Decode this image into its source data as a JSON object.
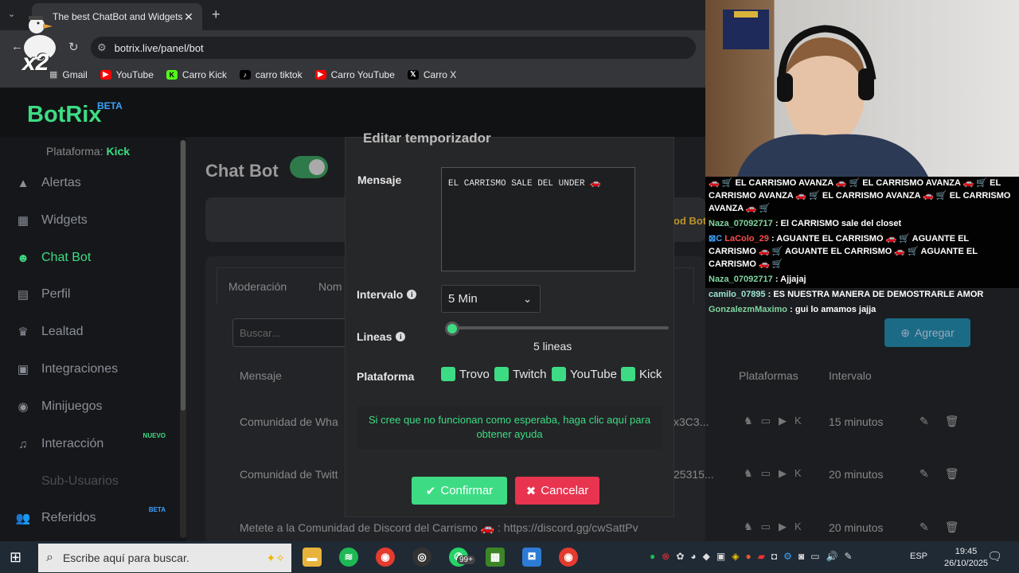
{
  "browser": {
    "tab_title": "The best ChatBot and Widgets",
    "tab_close": "✕",
    "new_tab": "+",
    "url": "botrix.live/panel/bot",
    "bookmarks": [
      {
        "label": "Gmail",
        "icon": "apps-icon",
        "color": "#888888"
      },
      {
        "label": "YouTube",
        "icon": "youtube-icon",
        "color": "#ff0000"
      },
      {
        "label": "Carro Kick",
        "icon": "kick-icon",
        "color": "#53fc18"
      },
      {
        "label": "carro tiktok",
        "icon": "tiktok-icon",
        "color": "#000000"
      },
      {
        "label": "Carro YouTube",
        "icon": "youtube-icon",
        "color": "#ff0000"
      },
      {
        "label": "Carro X",
        "icon": "x-icon",
        "color": "#000000"
      }
    ],
    "overlay_x2": "x2"
  },
  "app": {
    "logo": "BotRix",
    "beta": "BETA",
    "accent": "#3ddc84",
    "platform_label": "Plataforma:",
    "platform_value": "Kick"
  },
  "sidebar": {
    "items": [
      {
        "label": "Alertas",
        "icon": "warning-icon"
      },
      {
        "label": "Widgets",
        "icon": "widgets-icon"
      },
      {
        "label": "Chat Bot",
        "icon": "bot-icon",
        "active": true
      },
      {
        "label": "Perfil",
        "icon": "profile-card-icon"
      },
      {
        "label": "Lealtad",
        "icon": "trophy-icon"
      },
      {
        "label": "Integraciones",
        "icon": "integrations-icon"
      },
      {
        "label": "Minijuegos",
        "icon": "gamepad-icon"
      },
      {
        "label": "Interacción",
        "icon": "music-icon",
        "tag": "NUEVO"
      },
      {
        "label": "Sub-Usuarios",
        "icon": "",
        "disabled": true
      },
      {
        "label": "Referidos",
        "icon": "users-icon",
        "tag": "BETA"
      }
    ]
  },
  "main": {
    "title": "Chat Bot",
    "banner_text": "od BotRix ... la funció",
    "tabs": [
      "Moderación",
      "Nom"
    ],
    "search_placeholder": "Buscar...",
    "add_label": "Agregar",
    "headers": {
      "message": "Mensaje",
      "platforms": "Plataformas",
      "interval": "Intervalo"
    },
    "rows": [
      {
        "text": "Comunidad de Wha",
        "tail": "x3C3...",
        "interval": "15 minutos"
      },
      {
        "text": "Comunidad de Twitt",
        "tail": "25315...",
        "interval": "20 minutos"
      },
      {
        "text": "Metete a la Comunidad de Discord del Carrismo 🚗 : https://discord.gg/cwSattPv",
        "tail": "",
        "interval": "20 minutos"
      }
    ]
  },
  "modal": {
    "title": "Editar temporizador",
    "message_label": "Mensaje",
    "message_value": "EL CARRISMO SALE DEL UNDER 🚗",
    "interval_label": "Intervalo",
    "interval_value": "5 Min",
    "lines_label": "Lineas",
    "lines_value": "5 lineas",
    "lines_fraction": 0.0,
    "platform_label": "Plataforma",
    "platforms": [
      "Trovo",
      "Twitch",
      "YouTube",
      "Kick"
    ],
    "help": "Si cree que no funcionan como esperaba, haga clic aquí para obtener ayuda",
    "confirm": "Confirmar",
    "cancel": "Cancelar",
    "confirm_color": "#3ddc84",
    "cancel_color": "#e8344f"
  },
  "chat": {
    "lines": [
      {
        "user": "",
        "text": "🚗 🛒 EL CARRISMO AVANZA 🚗 🛒 EL CARRISMO AVANZA 🚗 🛒 EL CARRISMO AVANZA 🚗 🛒 EL CARRISMO AVANZA 🚗 🛒 EL CARRISMO AVANZA 🚗 🛒"
      },
      {
        "user": "Naza_07092717",
        "text": ": El CARRISMO sale del closet"
      },
      {
        "user": "LaColo_29",
        "text": ": AGUANTE EL CARRISMO 🚗 🛒 AGUANTE EL CARRISMO 🚗 🛒 AGUANTE EL CARRISMO 🚗 🛒 AGUANTE EL CARRISMO 🚗 🛒",
        "red": true
      },
      {
        "user": "Naza_07092717",
        "text": ": Ajjajaj"
      },
      {
        "user": "camilo_07895",
        "text": ": ES NUESTRA MANERA DE DEMOSTRARLE AMOR",
        "teal": true
      },
      {
        "user": "GonzalezmMaximo",
        "text": ": gui lo amamos jajja"
      }
    ]
  },
  "taskbar": {
    "search_placeholder": "Escribe aquí para buscar.",
    "badge": "99+",
    "lang": "ESP",
    "time": "19:45",
    "date": "26/10/2025"
  }
}
